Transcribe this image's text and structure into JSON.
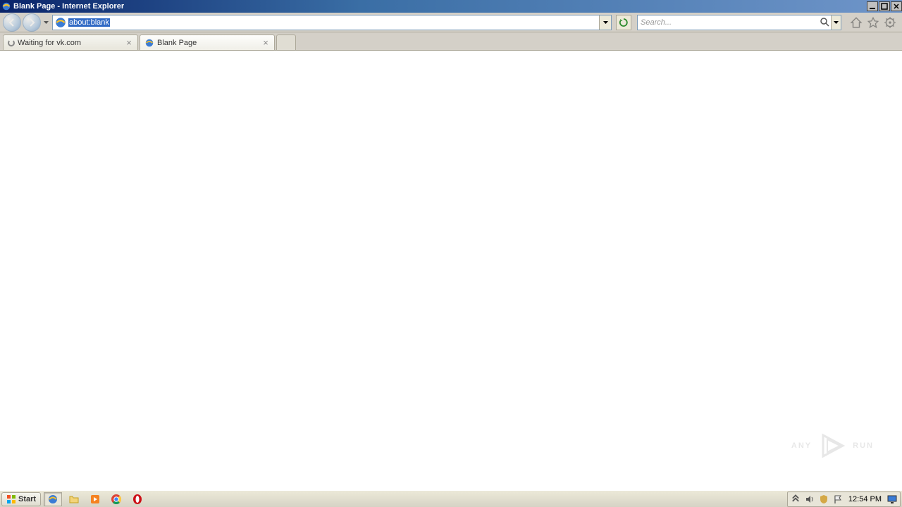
{
  "window": {
    "title": "Blank Page - Internet Explorer"
  },
  "addressbar": {
    "url": "about:blank"
  },
  "search": {
    "placeholder": "Search..."
  },
  "tabs": [
    {
      "title": "Waiting for vk.com",
      "loading": true
    },
    {
      "title": "Blank Page",
      "loading": false
    }
  ],
  "taskbar": {
    "start_label": "Start",
    "clock": "12:54 PM"
  },
  "watermark": {
    "left": "ANY",
    "right": "RUN"
  }
}
